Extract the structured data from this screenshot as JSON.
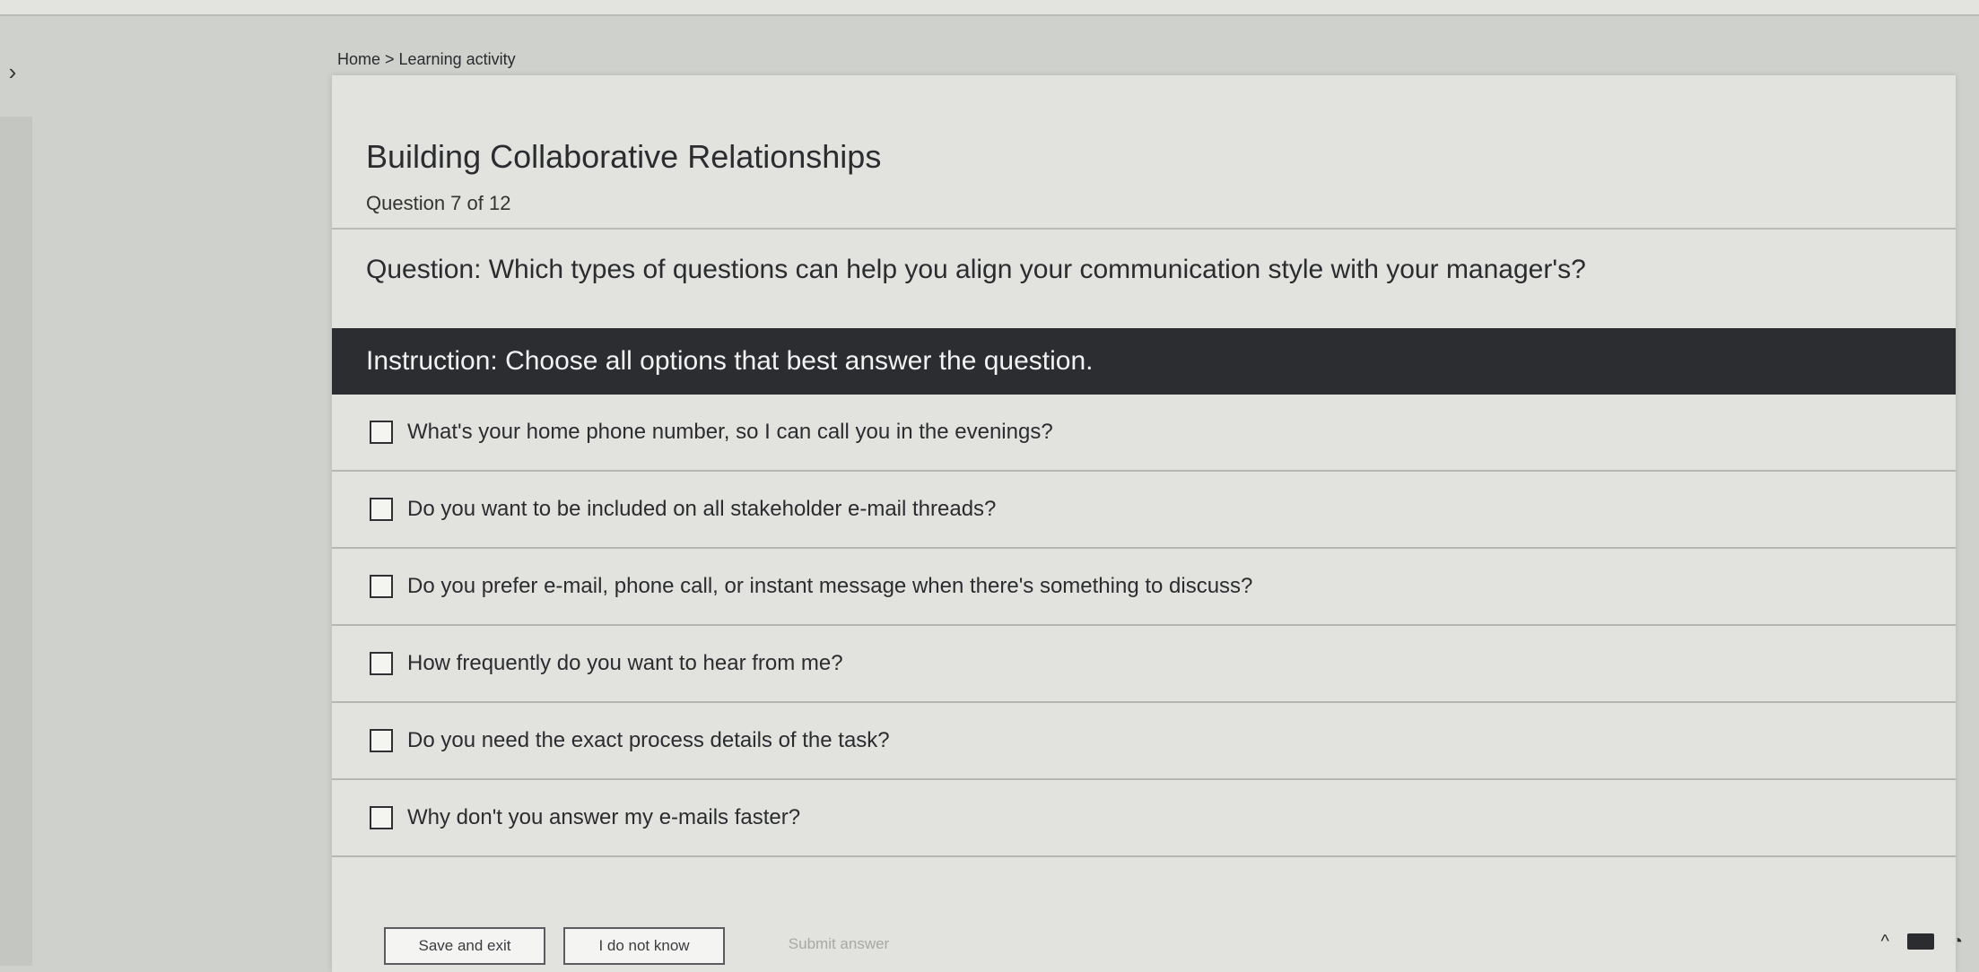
{
  "breadcrumb": "Home > Learning activity",
  "activity": {
    "title": "Building Collaborative Relationships",
    "progress_text": "Question 7 of 12"
  },
  "question": {
    "text": "Question: Which types of questions can help you align your communication style with your manager's?"
  },
  "instruction": {
    "text": "Instruction: Choose all options that best answer the question."
  },
  "options": [
    {
      "label": "What's your home phone number, so I can call you in the evenings?"
    },
    {
      "label": "Do you want to be included on all stakeholder e-mail threads?"
    },
    {
      "label": "Do you prefer e-mail, phone call, or instant message when there's something to discuss?"
    },
    {
      "label": "How frequently do you want to hear from me?"
    },
    {
      "label": "Do you need the exact process details of the task?"
    },
    {
      "label": "Why don't you answer my e-mails faster?"
    }
  ],
  "actions": {
    "save_exit": "Save and exit",
    "dont_know": "I do not know",
    "submit": "Submit answer"
  },
  "icons": {
    "sidebar_toggle": "chevron-right-icon",
    "tray_chevron": "chevron-up-icon",
    "battery": "battery-icon",
    "wifi": "wifi-icon"
  },
  "colors": {
    "instruction_bg": "#2c2d30",
    "card_bg": "#e2e3df"
  }
}
